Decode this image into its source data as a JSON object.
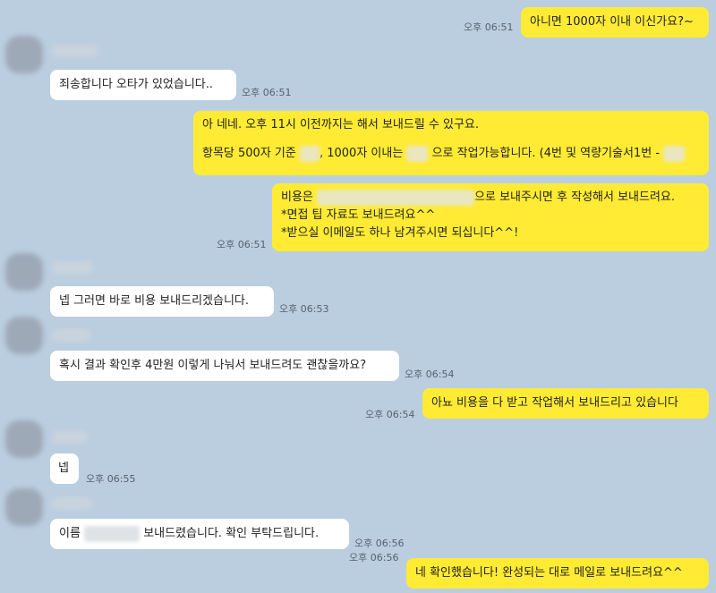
{
  "messages": [
    {
      "text": "아니면 1000자 이내 이신가요?~",
      "time": "오후 06:51"
    },
    {
      "text": "죄송합니다 오타가 있었습니다..",
      "time": "오후 06:51"
    },
    {
      "line1": "아 네네. 오후 11시 이전까지는 해서 보내드릴 수 있구요.",
      "line2a": "항목당 500자 기준",
      "line2b": ", 1000자 이내는",
      "line2c": "으로 작업가능합니다. (4번 및 역량기술서1번 -"
    },
    {
      "line1a": "비용은",
      "line1b": "으로 보내주시면 후 작성해서 보내드려요.",
      "line2": "*면접 팁 자료도 보내드려요^^",
      "line3": "*받으실 이메일도 하나 남겨주시면 되십니다^^!",
      "time": "오후 06:51"
    },
    {
      "text": "넵 그러면 바로 비용 보내드리겠습니다.",
      "time": "오후 06:53"
    },
    {
      "text": "혹시 결과 확인후 4만원 이렇게 나눠서 보내드려도 괜찮을까요?",
      "time": "오후 06:54"
    },
    {
      "text": "아뇨 비용을 다 받고 작업해서 보내드리고 있습니다",
      "time": "오후 06:54"
    },
    {
      "text": "넵",
      "time": "오후 06:55"
    },
    {
      "text_a": "이름",
      "text_b": "보내드렸습니다. 확인 부탁드립니다.",
      "time": "오후 06:56"
    },
    {
      "text": "네 확인했습니다! 완성되는 대로 메일로 보내드려요^^",
      "time": "오후 06:56"
    }
  ]
}
